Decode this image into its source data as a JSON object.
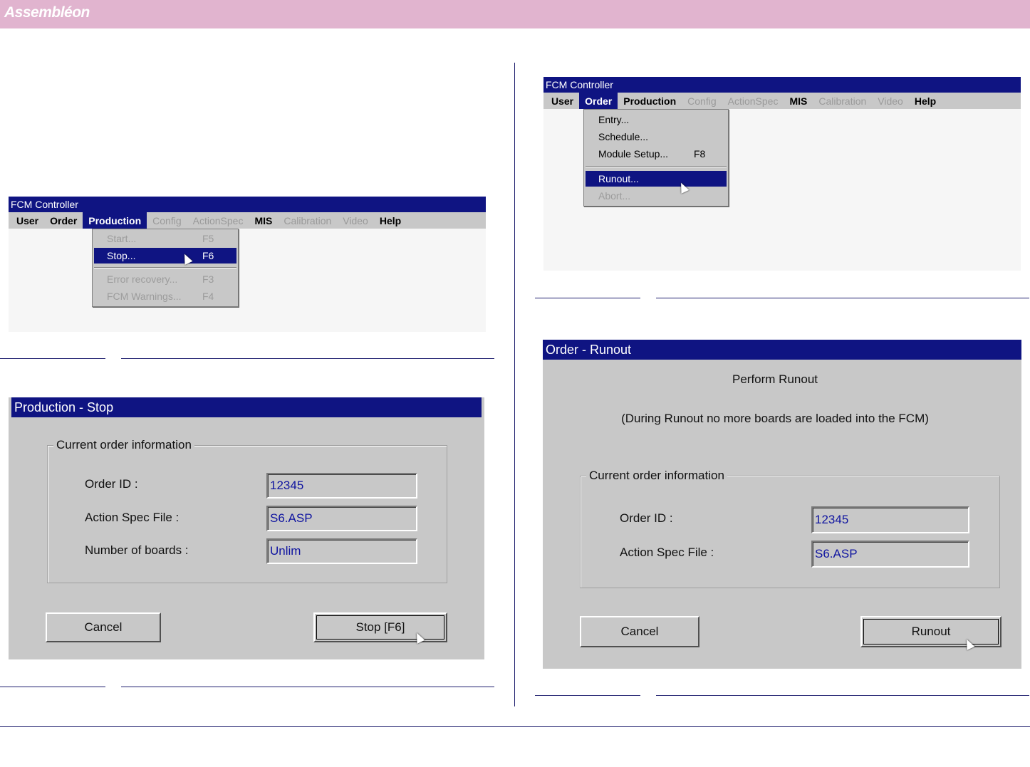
{
  "header": {
    "brand": "Assembléon",
    "color": "#e1b4cf"
  },
  "screen1": {
    "title": "FCM Controller",
    "menu": [
      "User",
      "Order",
      "Production",
      "Config",
      "ActionSpec",
      "MIS",
      "Calibration",
      "Video",
      "Help"
    ],
    "dropdown": {
      "items": [
        {
          "label": "Start...",
          "shortcut": "F5"
        },
        {
          "label": "Stop...",
          "shortcut": "F6"
        },
        {
          "label": "Error recovery...",
          "shortcut": "F3"
        },
        {
          "label": "FCM Warnings...",
          "shortcut": "F4"
        }
      ]
    }
  },
  "screen2": {
    "title": "FCM Controller",
    "menu": [
      "User",
      "Order",
      "Production",
      "Config",
      "ActionSpec",
      "MIS",
      "Calibration",
      "Video",
      "Help"
    ],
    "dropdown": {
      "items": [
        {
          "label": "Entry..."
        },
        {
          "label": "Schedule..."
        },
        {
          "label": "Module Setup...",
          "shortcut": "F8"
        },
        {
          "label": "Runout..."
        },
        {
          "label": "Abort..."
        }
      ]
    }
  },
  "stop_dialog": {
    "title": "Production - Stop",
    "group_title": "Current order information",
    "fields": [
      {
        "label": "Order ID :",
        "value": "12345"
      },
      {
        "label": "Action Spec File :",
        "value": "S6.ASP"
      },
      {
        "label": "Number of boards :",
        "value": "Unlim"
      }
    ],
    "cancel": "Cancel",
    "stop": "Stop [F6]"
  },
  "runout_dialog": {
    "title": "Order - Runout",
    "heading": "Perform Runout",
    "note": "(During Runout no more boards are loaded into the FCM)",
    "group_title": "Current order information",
    "fields": [
      {
        "label": "Order ID :",
        "value": "12345"
      },
      {
        "label": "Action Spec File :",
        "value": "S6.ASP"
      }
    ],
    "cancel": "Cancel",
    "runout": "Runout"
  }
}
